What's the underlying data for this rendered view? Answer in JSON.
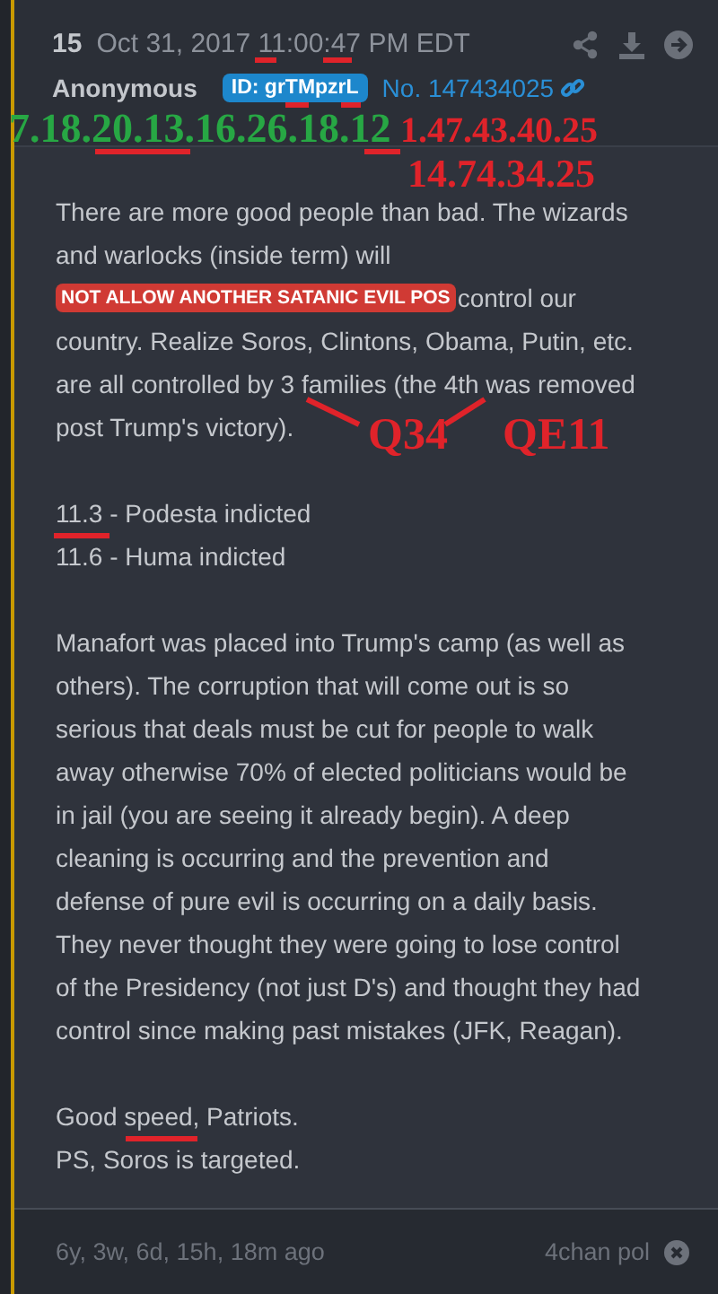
{
  "post": {
    "number": "15",
    "date": "Oct 31, 2017 11:00:47 PM EDT",
    "author": "Anonymous",
    "id_badge": "ID: grTMpzrL",
    "post_no": "No. 147434025"
  },
  "body": [
    {
      "lines": [
        "There are more good people than bad. The wizards",
        "and warlocks (inside term) will",
        {
          "badge": "NOT ALLOW ANOTHER SATANIC EVIL POS",
          "text": "control our"
        },
        "country. Realize Soros, Clintons, Obama, Putin, etc.",
        "are all controlled by 3 families (the 4th was removed",
        "post Trump's victory)."
      ]
    },
    {
      "lines": [
        "11.3 - Podesta indicted",
        "11.6 - Huma indicted"
      ]
    },
    {
      "lines": [
        "Manafort was placed into Trump's camp (as well as",
        "others). The corruption that will come out is so",
        "serious that deals must be cut for people to walk",
        "away otherwise 70% of elected politicians would be",
        "in jail (you are seeing it already begin). A deep",
        "cleaning is occurring and the prevention and",
        "defense of pure evil is occurring on a daily basis.",
        "They never thought they were going to lose control",
        "of the Presidency (not just D's) and thought they had",
        "control since making past mistakes (JFK, Reagan)."
      ]
    },
    {
      "lines": [
        "Good speed, Patriots.",
        "PS, Soros is targeted."
      ]
    }
  ],
  "annotations": [
    {
      "text": "7.18.20.13.16.26.18.12",
      "color": "#27a744"
    },
    {
      "text": "1.47.43.40.25",
      "color": "#e0232a"
    },
    {
      "text": "14.74.34.25",
      "color": "#e0232a"
    },
    {
      "text": "Q34",
      "color": "#e0232a"
    },
    {
      "text": "QE11",
      "color": "#e0232a"
    }
  ],
  "footer": {
    "age": "6y, 3w, 6d, 15h, 18m ago",
    "source": "4chan pol"
  }
}
